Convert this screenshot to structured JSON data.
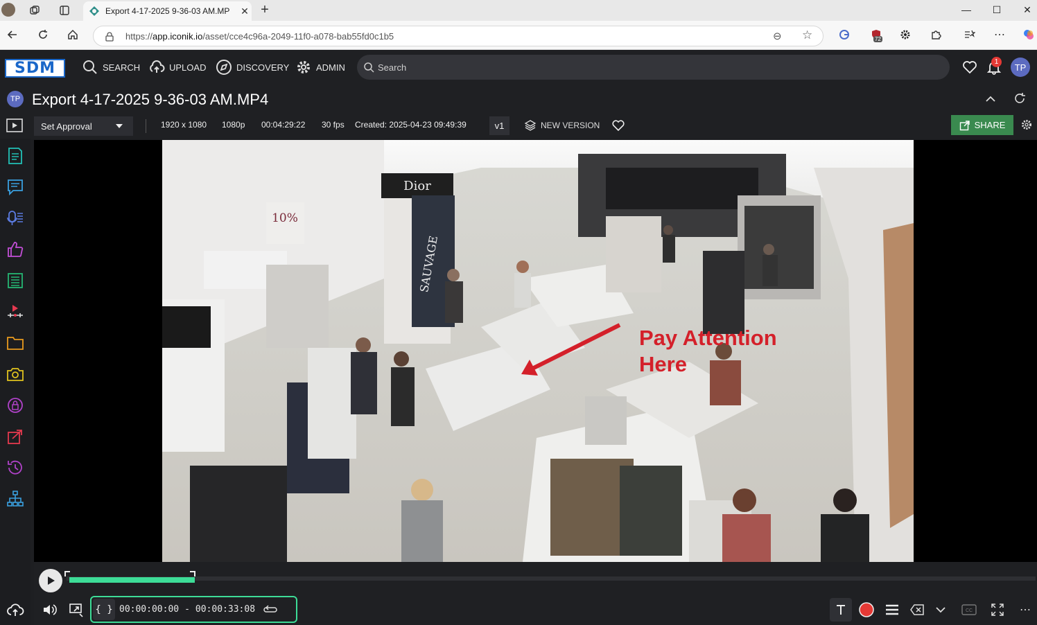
{
  "browser": {
    "tab_title": "Export 4-17-2025 9-36-03 AM.MP",
    "url_scheme": "https://",
    "url_host": "app.iconik.io",
    "url_path": "/asset/cce4c96a-2049-11f0-a078-bab55fd0c1b5",
    "extension_badge": "72"
  },
  "app": {
    "logo": "SDM",
    "nav": [
      "SEARCH",
      "UPLOAD",
      "DISCOVERY",
      "ADMIN"
    ],
    "search_placeholder": "Search",
    "notification_count": "1",
    "user_initials": "TP"
  },
  "asset": {
    "owner_initials": "TP",
    "title": "Export 4-17-2025 9-36-03 AM.MP4",
    "approval": "Set Approval",
    "resolution": "1920 x 1080",
    "quality": "1080p",
    "duration": "00:04:29:22",
    "fps": "30 fps",
    "created": "Created: 2025-04-23 09:49:39",
    "version": "v1",
    "new_version": "NEW VERSION",
    "share": "SHARE"
  },
  "video": {
    "annotation_line1": "Pay Attention",
    "annotation_line2": "Here",
    "sign_dior": "Dior",
    "sign_discount": "10%",
    "sign_sauvage": "SAUVAGE"
  },
  "player": {
    "timecode_in": "00:00:00:00",
    "timecode_separator": "-",
    "timecode_out": "00:00:33:08",
    "selection_fraction": 0.13
  },
  "colors": {
    "accent_green": "#3ddc97",
    "share_green": "#3a8a4f",
    "annotation_red": "#d4202a",
    "notification_red": "#e53935"
  }
}
